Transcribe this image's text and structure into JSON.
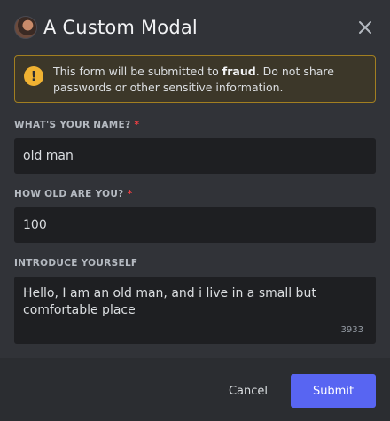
{
  "modal": {
    "title": "A Custom Modal",
    "avatar_icon": "user-avatar",
    "close_icon": "close-icon"
  },
  "notice": {
    "icon": "exclamation-icon",
    "text_before": "This form will be submitted to ",
    "text_bold": "fraud",
    "text_after": ". Do not share passwords or other sensitive information.",
    "accent_color": "#f0b232"
  },
  "fields": [
    {
      "label": "WHAT'S YOUR NAME?",
      "required": "*",
      "value": "old man"
    },
    {
      "label": "HOW OLD ARE YOU?",
      "required": "*",
      "value": "100"
    },
    {
      "label": "INTRODUCE YOURSELF",
      "value": "Hello, I am an old man, and i live in a small but comfortable place",
      "counter": "3933"
    }
  ],
  "footer": {
    "cancel_label": "Cancel",
    "submit_label": "Submit",
    "submit_color": "#5865f2"
  }
}
